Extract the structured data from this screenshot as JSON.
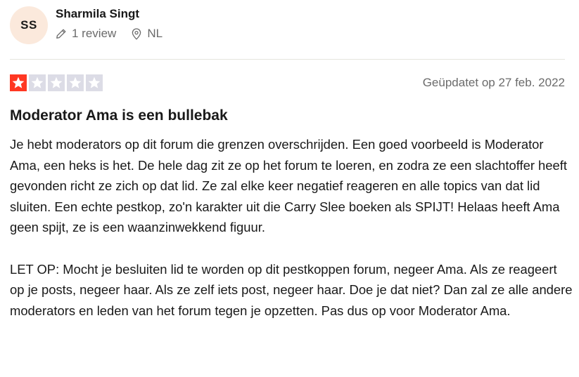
{
  "consumer": {
    "initials": "SS",
    "name": "Sharmila Singt",
    "reviews": "1 review",
    "country": "NL"
  },
  "rating": {
    "value": 1,
    "max": 5,
    "filled_color": "#ff3722",
    "empty_color": "#dcdce6"
  },
  "review": {
    "date": "Geüpdatet op 27 feb. 2022",
    "title": "Moderator Ama is een bullebak",
    "paragraphs": [
      "Je hebt moderators op dit forum die grenzen overschrijden. Een goed voorbeeld is Moderator Ama, een heks is het. De hele dag zit ze op het forum te loeren, en zodra ze een slachtoffer heeft gevonden richt ze zich op dat lid. Ze zal elke keer negatief reageren en alle topics van dat lid sluiten. Een echte pestkop, zo'n karakter uit die Carry Slee boeken als SPIJT! Helaas heeft Ama geen spijt, ze is een waanzinwekkend figuur.",
      "LET OP: Mocht je besluiten lid te worden op dit pestkoppen forum, negeer Ama. Als ze reageert op je posts, negeer haar. Als ze zelf iets post, negeer haar. Doe je dat niet? Dan zal ze alle andere moderators en leden van het forum tegen je opzetten. Pas dus op voor Moderator Ama."
    ]
  }
}
